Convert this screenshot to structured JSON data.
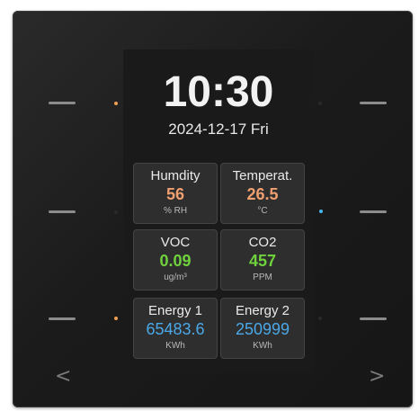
{
  "clock": {
    "time": "10:30",
    "date": "2024-12-17 Fri"
  },
  "tiles": [
    {
      "label": "Humdity",
      "value": "56",
      "unit": "% RH",
      "color": "#f0a070"
    },
    {
      "label": "Temperat.",
      "value": "26.5",
      "unit": "°C",
      "color": "#f0a070"
    },
    {
      "label": "VOC",
      "value": "0.09",
      "unit": "ug/m³",
      "color": "#6fd23c"
    },
    {
      "label": "CO2",
      "value": "457",
      "unit": "PPM",
      "color": "#6fd23c"
    },
    {
      "label": "Energy 1",
      "value": "65483.6",
      "unit": "KWh",
      "color": "#4aa8e8"
    },
    {
      "label": "Energy 2",
      "value": "250999",
      "unit": "KWh",
      "color": "#4aa8e8"
    }
  ],
  "nav": {
    "prev": "<",
    "next": ">"
  },
  "indicators": {
    "orange": "#f0a050",
    "blue": "#4ab4f0",
    "off": "#2a2a2a"
  }
}
